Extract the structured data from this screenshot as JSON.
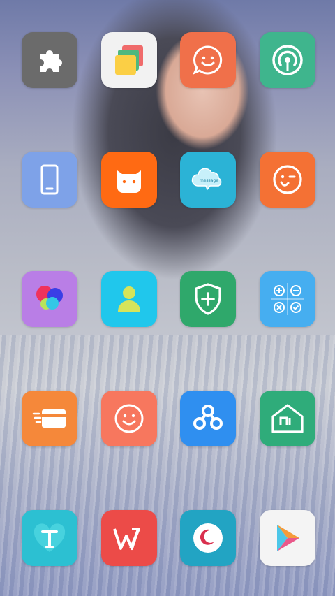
{
  "wallpaper": "portrait-photo",
  "apps": [
    {
      "name": "plugins",
      "icon": "puzzle-icon",
      "color": "#6b6b6b"
    },
    {
      "name": "themes",
      "icon": "themes-cards-icon",
      "color": "#f2f2f2"
    },
    {
      "name": "messaging",
      "icon": "smile-chat-icon",
      "color": "#f0704a"
    },
    {
      "name": "broadcast",
      "icon": "radio-signal-icon",
      "color": "#3fb58d"
    },
    {
      "name": "phone-manager",
      "icon": "phone-icon",
      "color": "#7ea2e8"
    },
    {
      "name": "mi-community",
      "icon": "mi-bunny-icon",
      "color": "#ff6a13"
    },
    {
      "name": "messages",
      "icon": "message-cloud-icon",
      "color": "#2bb3d6",
      "label": "message"
    },
    {
      "name": "feedback",
      "icon": "wink-face-icon",
      "color": "#f47134"
    },
    {
      "name": "gallery",
      "icon": "color-circles-icon",
      "color": "#b97ee6"
    },
    {
      "name": "contacts",
      "icon": "person-icon",
      "color": "#20c7ec"
    },
    {
      "name": "security",
      "icon": "shield-plus-icon",
      "color": "#2fa86b"
    },
    {
      "name": "calculator",
      "icon": "calculator-icon",
      "color": "#46aef0"
    },
    {
      "name": "wallet",
      "icon": "card-icon",
      "color": "#f5883a"
    },
    {
      "name": "mood",
      "icon": "smile-face-icon",
      "color": "#f7775e"
    },
    {
      "name": "cloud-drive",
      "icon": "cloud-link-icon",
      "color": "#2f8ff0"
    },
    {
      "name": "mi-home",
      "icon": "mi-house-icon",
      "color": "#2fac7a"
    },
    {
      "name": "fonts",
      "icon": "heart-t-icon",
      "color": "#2cc0d2"
    },
    {
      "name": "wps-office",
      "icon": "wps-icon",
      "color": "#ec4b48"
    },
    {
      "name": "night-mode",
      "icon": "moon-icon",
      "color": "#22a4c3"
    },
    {
      "name": "play-store",
      "icon": "play-triangle-icon",
      "color": "#f4f4f4"
    }
  ]
}
